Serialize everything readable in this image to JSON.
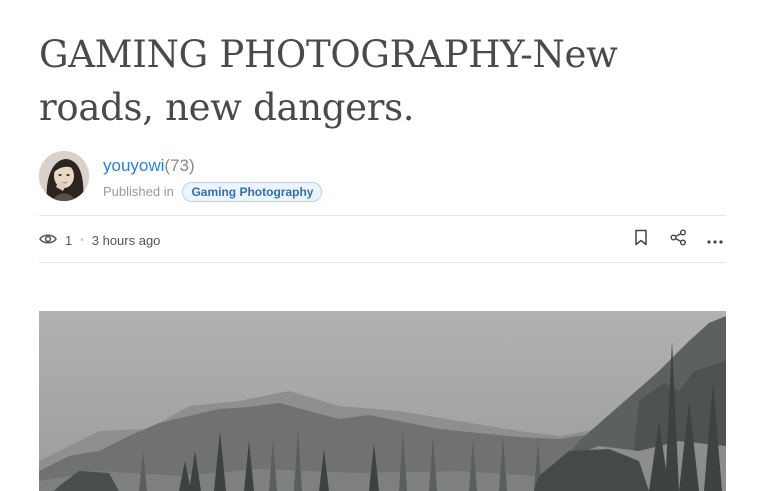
{
  "article": {
    "title": "GAMING PHOTOGRAPHY-New roads, new dangers."
  },
  "author": {
    "name": "youyowi",
    "reputation": "(73)",
    "published_prefix": "Published in",
    "category": "Gaming Photography"
  },
  "meta": {
    "views": "1",
    "separator": "•",
    "time": "3 hours ago"
  },
  "icons": {
    "views": "eye-icon",
    "bookmark": "bookmark-icon",
    "share": "share-icon",
    "more": "more-icon"
  },
  "colors": {
    "link": "#2f7fd0",
    "badge_text": "#2f6fb8",
    "badge_bg": "#eef4fb"
  }
}
